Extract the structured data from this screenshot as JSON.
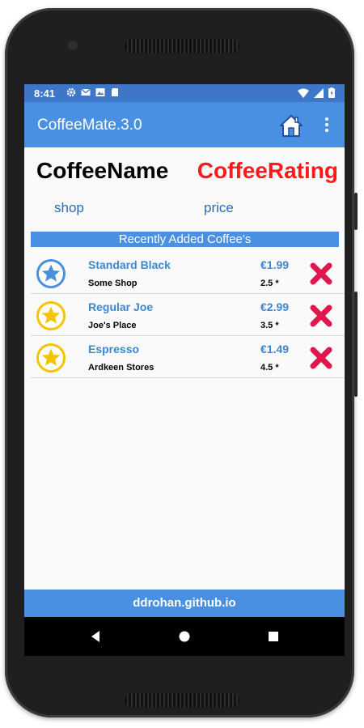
{
  "status": {
    "time": "8:41"
  },
  "app": {
    "title": "CoffeeMate.3.0"
  },
  "header": {
    "coffee_name": "CoffeeName",
    "coffee_rating": "CoffeeRating",
    "shop": "shop",
    "price": "price"
  },
  "list": {
    "heading": "Recently Added Coffee's",
    "items": [
      {
        "name": "Standard Black",
        "shop": "Some Shop",
        "price": "€1.99",
        "rating": "2.5 *",
        "favourite": false
      },
      {
        "name": "Regular Joe",
        "shop": "Joe's Place",
        "price": "€2.99",
        "rating": "3.5 *",
        "favourite": true
      },
      {
        "name": "Espresso",
        "shop": "Ardkeen Stores",
        "price": "€1.49",
        "rating": "4.5 *",
        "favourite": true
      }
    ]
  },
  "footer": {
    "text": "ddrohan.github.io"
  },
  "colors": {
    "accent": "#4a90e2",
    "status_bar": "#3e77c8",
    "rating_red": "#ff1a1a",
    "delete_red": "#e0174f",
    "star_blue": "#4a90e2",
    "star_gold": "#f5c400"
  },
  "icons": {
    "home": "home-icon",
    "menu": "more-vert-icon",
    "star": "star-icon",
    "delete": "delete-cross-icon"
  }
}
